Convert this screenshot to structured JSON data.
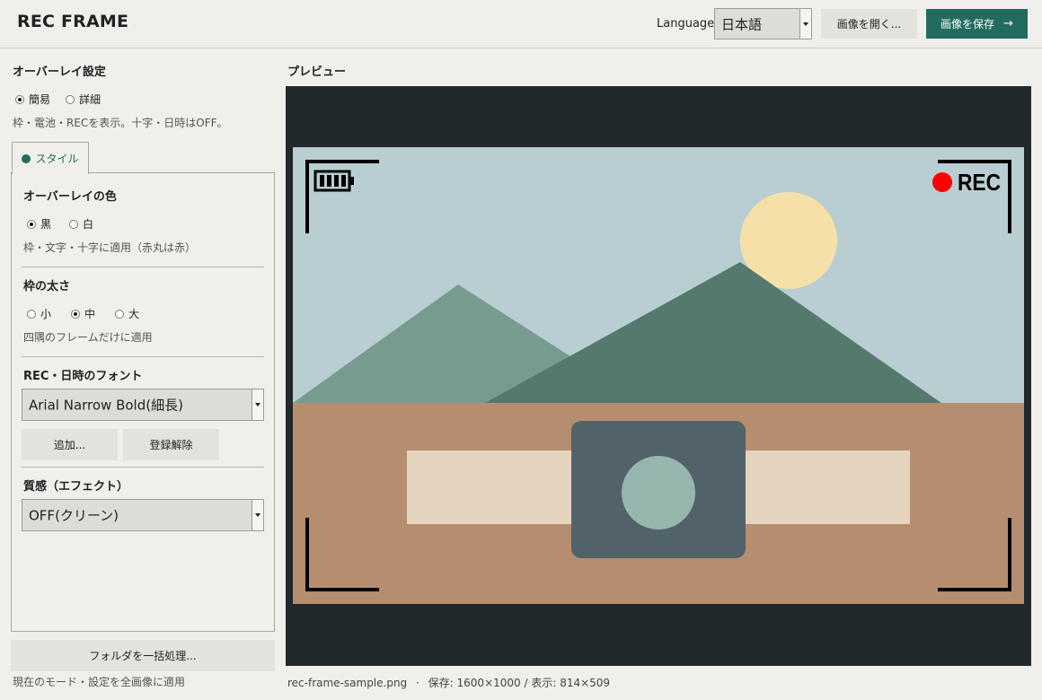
{
  "header": {
    "app_title": "REC FRAME",
    "language_label": "Language",
    "language_value": "日本語",
    "open_label": "画像を開く...",
    "save_label": "画像を保存",
    "save_arrow": "→"
  },
  "overlay": {
    "title": "オーバーレイ設定",
    "mode_options": [
      "簡易",
      "詳細"
    ],
    "mode_selected": "簡易",
    "mode_hint": "枠・電池・RECを表示。十字・日時はOFF。",
    "tab_label": "スタイル"
  },
  "color": {
    "title": "オーバーレイの色",
    "options": [
      "黒",
      "白"
    ],
    "selected": "黒",
    "hint": "枠・文字・十字に適用（赤丸は赤）"
  },
  "thickness": {
    "title": "枠の太さ",
    "options": [
      "小",
      "中",
      "大"
    ],
    "selected": "中",
    "hint": "四隅のフレームだけに適用"
  },
  "font": {
    "title": "REC・日時のフォント",
    "value": "Arial Narrow Bold(細長)",
    "add_label": "追加...",
    "remove_label": "登録解除"
  },
  "effect": {
    "title": "質感（エフェクト）",
    "value": "OFF(クリーン)"
  },
  "batch": {
    "button_label": "フォルダを一括処理...",
    "hint": "現在のモード・設定を全画像に適用"
  },
  "preview": {
    "label": "プレビュー",
    "rec_text": "REC",
    "filename": "rec-frame-sample.png",
    "info": "保存: 1600×1000 / 表示: 814×509",
    "separator": "·"
  },
  "colors": {
    "accent": "#236b5f",
    "sky": "#b8ced2",
    "ground": "#b48e6e",
    "sun": "#f5e1a8",
    "mountain_back": "#779b8f",
    "mountain_front": "#56796d",
    "band": "#e4d4bd",
    "camera_body": "#52626a",
    "lens": "#97b6ad",
    "rec_dot": "#ff0000",
    "overlay": "#000000"
  }
}
